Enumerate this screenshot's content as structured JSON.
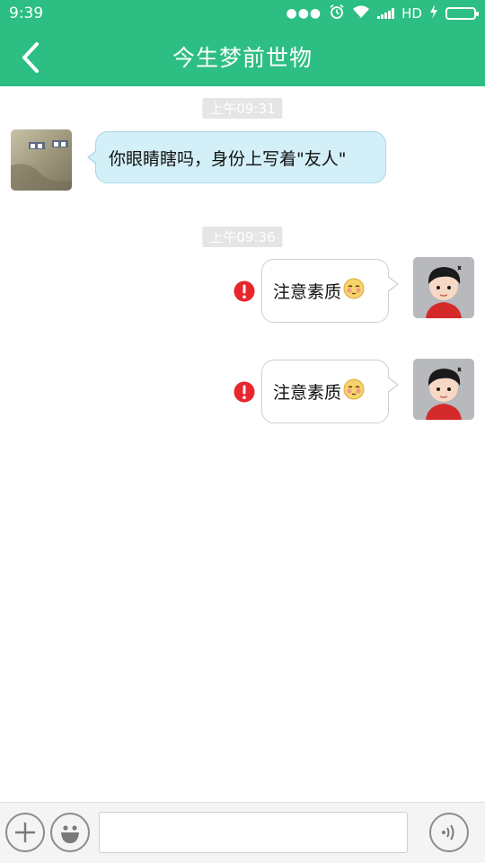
{
  "status_bar": {
    "time": "9:39",
    "network": "HD",
    "icons": [
      "more-dots-icon",
      "alarm-icon",
      "wifi-icon",
      "signal-icon",
      "charging-icon",
      "battery-icon"
    ]
  },
  "header": {
    "title": "今生梦前世物",
    "back_icon": "chevron-left-icon",
    "color": "#2dbe83"
  },
  "messages": [
    {
      "type": "timestamp",
      "text": "上午09:31"
    },
    {
      "type": "received",
      "text": "你眼睛瞎吗，身份上写着\"友人\"",
      "status": ""
    },
    {
      "type": "timestamp",
      "text": "上午09:36"
    },
    {
      "type": "sent",
      "text": "注意素质",
      "emoji": "blush-face-emoji",
      "status": "failed"
    },
    {
      "type": "sent",
      "text": "注意素质",
      "emoji": "blush-face-emoji",
      "status": "failed"
    }
  ],
  "input_bar": {
    "plus_icon": "plus-icon",
    "emoji_icon": "smiley-icon",
    "voice_icon": "voice-icon",
    "input_value": "",
    "input_placeholder": ""
  },
  "colors": {
    "accent": "#2dbe83",
    "received_bubble": "#d3eff7",
    "sent_bubble": "#ffffff",
    "error": "#e8262c"
  }
}
